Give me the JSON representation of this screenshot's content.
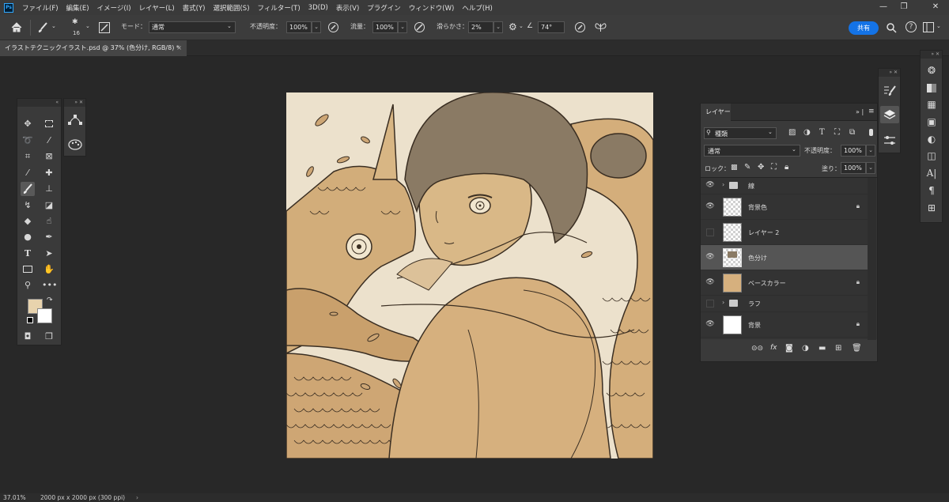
{
  "menubar": {
    "logo": "Ps",
    "items": [
      "ファイル(F)",
      "編集(E)",
      "イメージ(I)",
      "レイヤー(L)",
      "書式(Y)",
      "選択範囲(S)",
      "フィルター(T)",
      "3D(D)",
      "表示(V)",
      "プラグイン",
      "ウィンドウ(W)",
      "ヘルプ(H)"
    ],
    "window_controls": [
      "—",
      "❐",
      "✕"
    ]
  },
  "options": {
    "brush_size": "16",
    "mode_label": "モード：",
    "mode_value": "通常",
    "opacity_label": "不透明度：",
    "opacity_value": "100%",
    "flow_label": "流量：",
    "flow_value": "100%",
    "smoothing_label": "滑らかさ：",
    "smoothing_value": "2%",
    "angle_value": "74°",
    "share_label": "共有"
  },
  "document": {
    "tab_title": "イラストテクニックイラスト.psd @ 37% (色分け, RGB/8) *",
    "close": "×"
  },
  "layers_panel": {
    "tab": "レイヤー",
    "filter_kind": "種類",
    "blend_mode": "通常",
    "opacity_label": "不透明度：",
    "opacity_value": "100%",
    "lock_label": "ロック：",
    "fill_label": "塗り：",
    "fill_value": "100%",
    "layers": [
      {
        "name": "線",
        "type": "group",
        "visible": true
      },
      {
        "name": "背景色",
        "type": "layer",
        "visible": true,
        "locked": true
      },
      {
        "name": "レイヤー 2",
        "type": "layer",
        "visible": false
      },
      {
        "name": "色分け",
        "type": "layer",
        "visible": true,
        "selected": true
      },
      {
        "name": "ベースカラー",
        "type": "layer",
        "visible": true,
        "locked": true
      },
      {
        "name": "ラフ",
        "type": "group",
        "visible": false
      },
      {
        "name": "背景",
        "type": "layer",
        "visible": true,
        "locked": true
      }
    ]
  },
  "colors": {
    "foreground": "#e8d3ad",
    "background": "#ffffff",
    "accent": "#1473e6",
    "canvas_base": "#ece1cc",
    "ink": "#3a2e22"
  },
  "status": {
    "zoom": "37.01%",
    "doc_info": "2000 px x 2000 px (300 ppi)"
  }
}
